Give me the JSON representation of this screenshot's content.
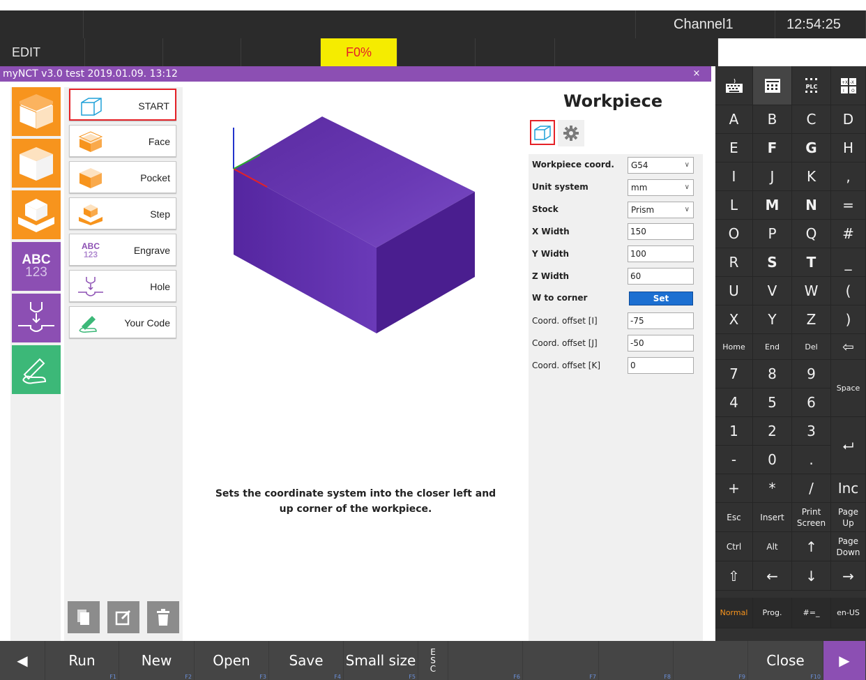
{
  "header": {
    "channel": "Channel1",
    "time": "12:54:25",
    "mode": "EDIT",
    "feed": "F0%"
  },
  "window": {
    "title": "myNCT v3.0 test 2019.01.09. 13:12",
    "close_symbol": "×"
  },
  "operations": [
    {
      "label": "START",
      "icon": "box-outline-icon",
      "selected": true
    },
    {
      "label": "Face",
      "icon": "face-icon"
    },
    {
      "label": "Pocket",
      "icon": "pocket-icon"
    },
    {
      "label": "Step",
      "icon": "step-icon"
    },
    {
      "label": "Engrave",
      "icon": "engrave-icon",
      "icon_text": "ABC\n123"
    },
    {
      "label": "Hole",
      "icon": "hole-icon"
    },
    {
      "label": "Your Code",
      "icon": "hand-pen-icon"
    }
  ],
  "left_tiles": [
    {
      "icon": "face-tile-icon",
      "color": "#f7941d"
    },
    {
      "icon": "pocket-tile-icon",
      "color": "#f7941d"
    },
    {
      "icon": "step-tile-icon",
      "color": "#f7941d"
    },
    {
      "icon": "engrave-tile-icon",
      "color": "#8c4fb3",
      "text_top": "ABC",
      "text_bottom": "123"
    },
    {
      "icon": "hole-tile-icon",
      "color": "#8c4fb3"
    },
    {
      "icon": "hand-pen-tile-icon",
      "color": "#3cb878"
    }
  ],
  "viewer": {
    "caption_line1": "Sets the coordinate system into the closer left and",
    "caption_line2": "up corner of the workpiece.",
    "box_color": "#5b2aa3"
  },
  "panel": {
    "title": "Workpiece",
    "fields": [
      {
        "label": "Workpiece coord.",
        "type": "select",
        "value": "G54"
      },
      {
        "label": "Unit system",
        "type": "select",
        "value": "mm"
      },
      {
        "label": "Stock",
        "type": "select",
        "value": "Prism"
      },
      {
        "label": "X Width",
        "type": "input",
        "value": "150"
      },
      {
        "label": "Y Width",
        "type": "input",
        "value": "100"
      },
      {
        "label": "Z Width",
        "type": "input",
        "value": "60"
      },
      {
        "label": "W to corner",
        "type": "button",
        "value": "Set"
      },
      {
        "label": "Coord. offset [I]",
        "type": "input",
        "value": "-75"
      },
      {
        "label": "Coord. offset [J]",
        "type": "input",
        "value": "-50"
      },
      {
        "label": "Coord. offset [K]",
        "type": "input",
        "value": "0"
      }
    ]
  },
  "keyboard": {
    "tabs": [
      "keyboard-icon",
      "numpad-icon",
      "plc-icon",
      "io-icon"
    ],
    "rows": [
      [
        "A",
        "B",
        "C",
        "D"
      ],
      [
        "E",
        "F",
        "G",
        "H"
      ],
      [
        "I",
        "J",
        "K",
        ","
      ],
      [
        "L",
        "M",
        "N",
        "="
      ],
      [
        "O",
        "P",
        "Q",
        "#"
      ],
      [
        "R",
        "S",
        "T",
        "_"
      ],
      [
        "U",
        "V",
        "W",
        "("
      ],
      [
        "X",
        "Y",
        "Z",
        ")"
      ],
      [
        "Home",
        "End",
        "Del",
        "⇦"
      ],
      [
        "7",
        "8",
        "9"
      ],
      [
        "4",
        "5",
        "6"
      ],
      [
        "1",
        "2",
        "3"
      ],
      [
        "-",
        "0",
        "."
      ],
      [
        "+",
        "*",
        "/",
        "Inc"
      ],
      [
        "Esc",
        "Insert",
        "Print Screen",
        "Page Up"
      ],
      [
        "Ctrl",
        "Alt",
        "↑",
        "Page Down"
      ],
      [
        "⇧",
        "←",
        "↓",
        "→"
      ],
      [
        "Normal",
        "Prog.",
        "#=_",
        "en-US"
      ]
    ],
    "space": "Space",
    "enter": "⮠"
  },
  "bottom_bar": [
    {
      "label": "",
      "key": "",
      "icon": "left-arrow-icon"
    },
    {
      "label": "Run",
      "key": "F1"
    },
    {
      "label": "New",
      "key": "F2"
    },
    {
      "label": "Open",
      "key": "F3"
    },
    {
      "label": "Save",
      "key": "F4"
    },
    {
      "label": "Small size",
      "key": "F5"
    },
    {
      "label": "ESC",
      "key": ""
    },
    {
      "label": "",
      "key": "F6"
    },
    {
      "label": "",
      "key": "F7"
    },
    {
      "label": "",
      "key": "F8"
    },
    {
      "label": "",
      "key": "F9"
    },
    {
      "label": "Close",
      "key": "F10"
    },
    {
      "label": "",
      "key": "",
      "icon": "right-arrow-icon"
    }
  ]
}
